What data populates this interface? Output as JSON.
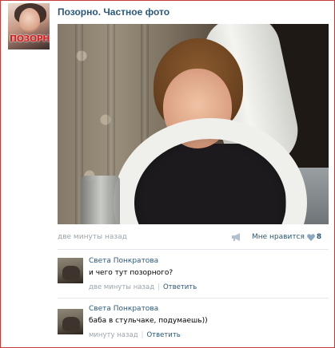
{
  "post": {
    "group_name": "Позорно. Частное фото",
    "avatar_logo_text": "ПОЗОРНО",
    "time": "две минуты назад",
    "like_label": "Мне нравится",
    "like_count": "8"
  },
  "comments": [
    {
      "author": "Света Понкратова",
      "text": "и чего тут позорного?",
      "time": "две минуты назад",
      "reply_label": "Ответить",
      "separator": "|"
    },
    {
      "author": "Света Понкратова",
      "text": "баба в стульчаке, подумаешь))",
      "time": "минуту назад",
      "reply_label": "Ответить",
      "separator": "|"
    }
  ],
  "colors": {
    "link": "#2b587a",
    "meta": "#9aa4ad",
    "frame_border": "#c63a3a",
    "divider": "#e4e8ed"
  }
}
